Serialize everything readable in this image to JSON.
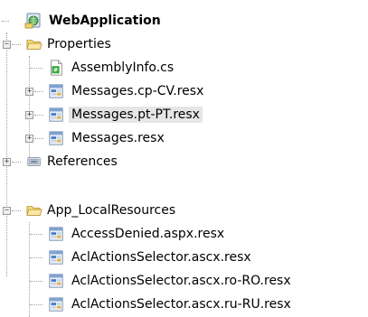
{
  "tree": {
    "root": {
      "label": "WebApplication",
      "icon": "web-project-icon"
    },
    "properties": {
      "label": "Properties",
      "toggle": "−",
      "icon": "folder-open-icon"
    },
    "assembly_info": {
      "label": "AssemblyInfo.cs",
      "icon": "cs-file-icon"
    },
    "messages_cp": {
      "label": "Messages.cp-CV.resx",
      "toggle": "+",
      "icon": "resx-file-icon"
    },
    "messages_pt": {
      "label": "Messages.pt-PT.resx",
      "toggle": "+",
      "icon": "resx-file-icon"
    },
    "messages": {
      "label": "Messages.resx",
      "toggle": "+",
      "icon": "resx-file-icon"
    },
    "references": {
      "label": "References",
      "toggle": "+",
      "icon": "references-icon"
    },
    "app_local": {
      "label": "App_LocalResources",
      "toggle": "−",
      "icon": "folder-open-icon"
    },
    "access_denied": {
      "label": "AccessDenied.aspx.resx",
      "icon": "resx-file-icon"
    },
    "acl_selector": {
      "label": "AclActionsSelector.ascx.resx",
      "icon": "resx-file-icon"
    },
    "acl_selector_ro": {
      "label": "AclActionsSelector.ascx.ro-RO.resx",
      "icon": "resx-file-icon"
    },
    "acl_selector_ru": {
      "label": "AclActionsSelector.ascx.ru-RU.resx",
      "icon": "resx-file-icon"
    }
  },
  "colors": {
    "selection": "#e6e6e6",
    "tree_line": "#a0a0a0",
    "folder": "#e8c25a",
    "resx": "#3f7cc4",
    "cs": "#3aa53a"
  }
}
